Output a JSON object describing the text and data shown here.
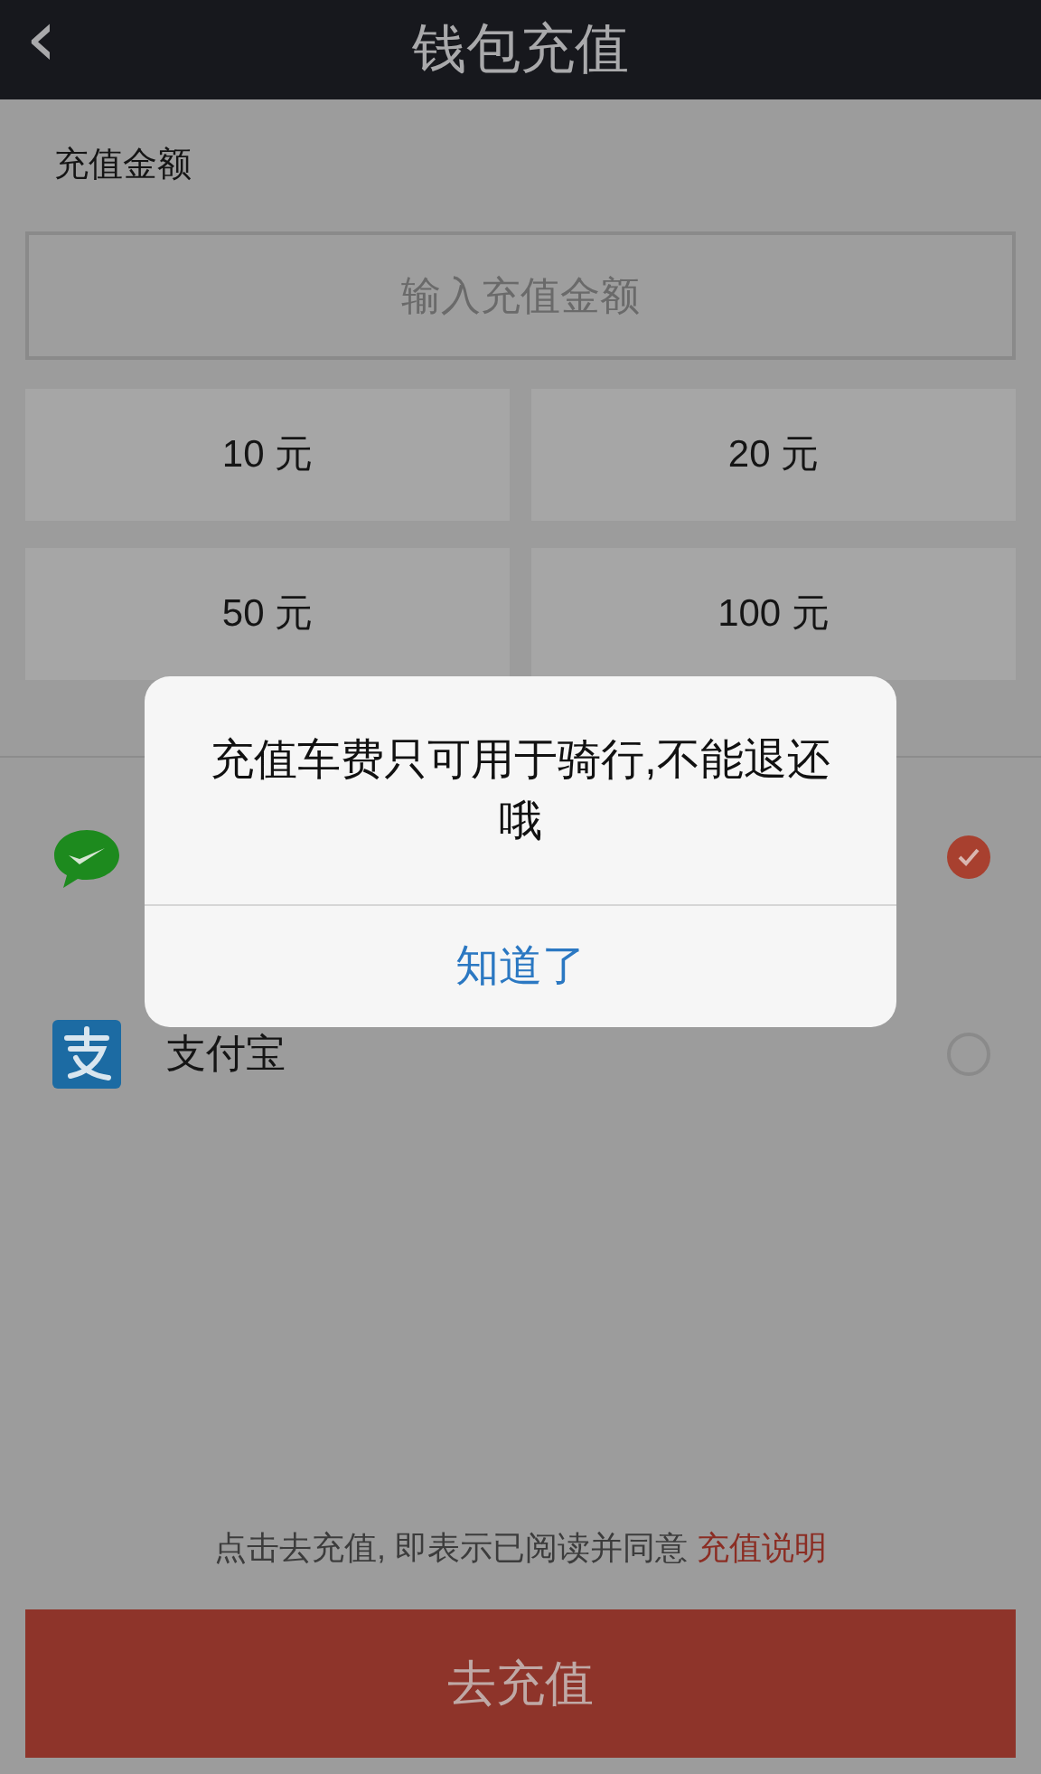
{
  "header": {
    "back_icon": "‹",
    "title": "钱包充值"
  },
  "amount_section": {
    "label": "充值金额",
    "input": {
      "placeholder": "输入充值金额"
    },
    "options": [
      "10 元",
      "20 元",
      "50 元",
      "100 元"
    ]
  },
  "payment_methods": [
    {
      "kind": "wechat",
      "selected": true
    },
    {
      "kind": "alipay",
      "label": "支付宝",
      "selected": false
    }
  ],
  "agreement": {
    "text": "点击去充值, 即表示已阅读并同意",
    "link": "充值说明"
  },
  "submit_button": "去充值",
  "dialog": {
    "message": "充值车费只可用于骑行,不能退还哦",
    "button": "知道了"
  }
}
